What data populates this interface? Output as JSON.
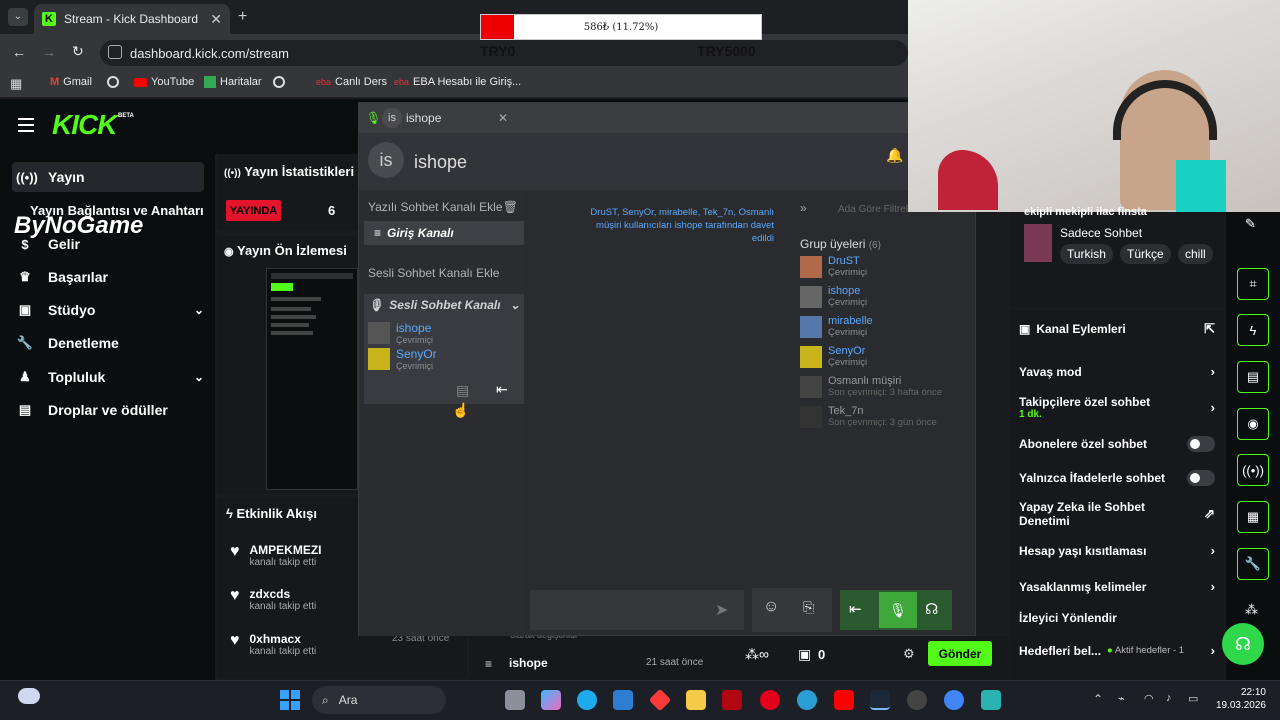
{
  "browser": {
    "tab_title": "Stream - Kick Dashboard",
    "url": "dashboard.kick.com/stream",
    "bookmarks": [
      "Gmail",
      "YouTube",
      "Haritalar",
      "Canlı Ders",
      "EBA Hesabı ile Giriş..."
    ]
  },
  "donation": {
    "text": "586₺ (11.72%)",
    "progress": 0.1172,
    "min_label": "TRY0",
    "max_label": "TRY5000"
  },
  "kick": {
    "logo": "KICK",
    "logo_badge": "BETA",
    "nav": [
      {
        "label": "Yayın",
        "icon": "broadcast-icon"
      },
      {
        "label": "Gelir",
        "icon": "dollar-icon"
      },
      {
        "label": "Başarılar",
        "icon": "trophy-icon"
      },
      {
        "label": "Stüdyo",
        "icon": "studio-icon"
      },
      {
        "label": "Denetleme",
        "icon": "wrench-icon"
      },
      {
        "label": "Topluluk",
        "icon": "community-icon"
      },
      {
        "label": "Droplar ve ödüller",
        "icon": "gift-icon"
      }
    ],
    "overlay_text": "ByNoGame",
    "stats_title": "Yayın İstatistikleri",
    "connection_title": "Yayın Bağlantısı ve Anahtarı",
    "live_badge": "YAYINDA",
    "viewer_count": "6",
    "preview_title": "Yayın Ön İzlemesi",
    "activity_title": "Etkinlik Akışı",
    "activity": [
      {
        "name": "AMPEKMEZI",
        "action": "kanalı takip etti",
        "time": ""
      },
      {
        "name": "zdxcds",
        "action": "kanalı takip etti",
        "time": ""
      },
      {
        "name": "0xhmacx",
        "action": "kanalı takip etti",
        "time": "23 saat önce"
      }
    ],
    "chat_footer": {
      "system_text": "olarak değiştirildi",
      "user": "ishope",
      "time": "21 saat önce",
      "count": "0",
      "send": "Gönder"
    },
    "stream_info": {
      "title_fragment": "ekipli mekipli ilac finsta",
      "category": "Sadece Sohbet",
      "tags": [
        "Turkish",
        "Türkçe",
        "chill"
      ]
    },
    "channel_actions_title": "Kanal Eylemleri",
    "actions": [
      {
        "label": "Yavaş mod",
        "kind": "chevron"
      },
      {
        "label": "Takipçilere özel sohbet",
        "sub": "1 dk.",
        "kind": "chevron"
      },
      {
        "label": "Abonelere özel sohbet",
        "kind": "toggle"
      },
      {
        "label": "Yalnızca İfadelerle sohbet",
        "kind": "toggle"
      },
      {
        "label": "Yapay Zeka ile Sohbet Denetimi",
        "kind": "external"
      },
      {
        "label": "Hesap yaşı kısıtlaması",
        "kind": "chevron"
      },
      {
        "label": "Yasaklanmış kelimeler",
        "kind": "chevron"
      },
      {
        "label": "İzleyici Yönlendir",
        "kind": "none"
      },
      {
        "label": "Hedefleri bel...",
        "sub": "Aktif hedefler - 1",
        "kind": "chevron"
      }
    ]
  },
  "chatapp": {
    "title": "ishope",
    "avatar_initials": "is",
    "text_add": "Yazılı Sohbet Kanalı Ekle",
    "text_channel": "Giriş Kanalı",
    "voice_add": "Sesli Sohbet Kanalı Ekle",
    "voice_channel": "Sesli Sohbet Kanalı",
    "voice_members": [
      {
        "name": "ishope",
        "status": "Çevrimiçi"
      },
      {
        "name": "SenyOr",
        "status": "Çevrimiçi"
      }
    ],
    "invite_text": "DruST, SenyOr, mirabelle, Tek_7n, Osmanlı müşiri kullanıcıları ishope tarafından davet edildi",
    "search_placeholder": "Ada Göre Filtrele",
    "group_title": "Grup üyeleri",
    "group_count": "(6)",
    "members": [
      {
        "name": "DruST",
        "status": "Çevrimiçi",
        "online": true
      },
      {
        "name": "ishope",
        "status": "Çevrimiçi",
        "online": true
      },
      {
        "name": "mirabelle",
        "status": "Çevrimiçi",
        "online": true
      },
      {
        "name": "SenyOr",
        "status": "Çevrimiçi",
        "online": true
      },
      {
        "name": "Osmanlı müşiri",
        "status": "Son çevrimiçi: 3 hafta önce",
        "online": false
      },
      {
        "name": "Tek_7n",
        "status": "Son çevrimiçi: 3 gün önce",
        "online": false
      }
    ]
  },
  "taskbar": {
    "search": "Ara",
    "time": "22:10",
    "date": "19.03.2026"
  }
}
